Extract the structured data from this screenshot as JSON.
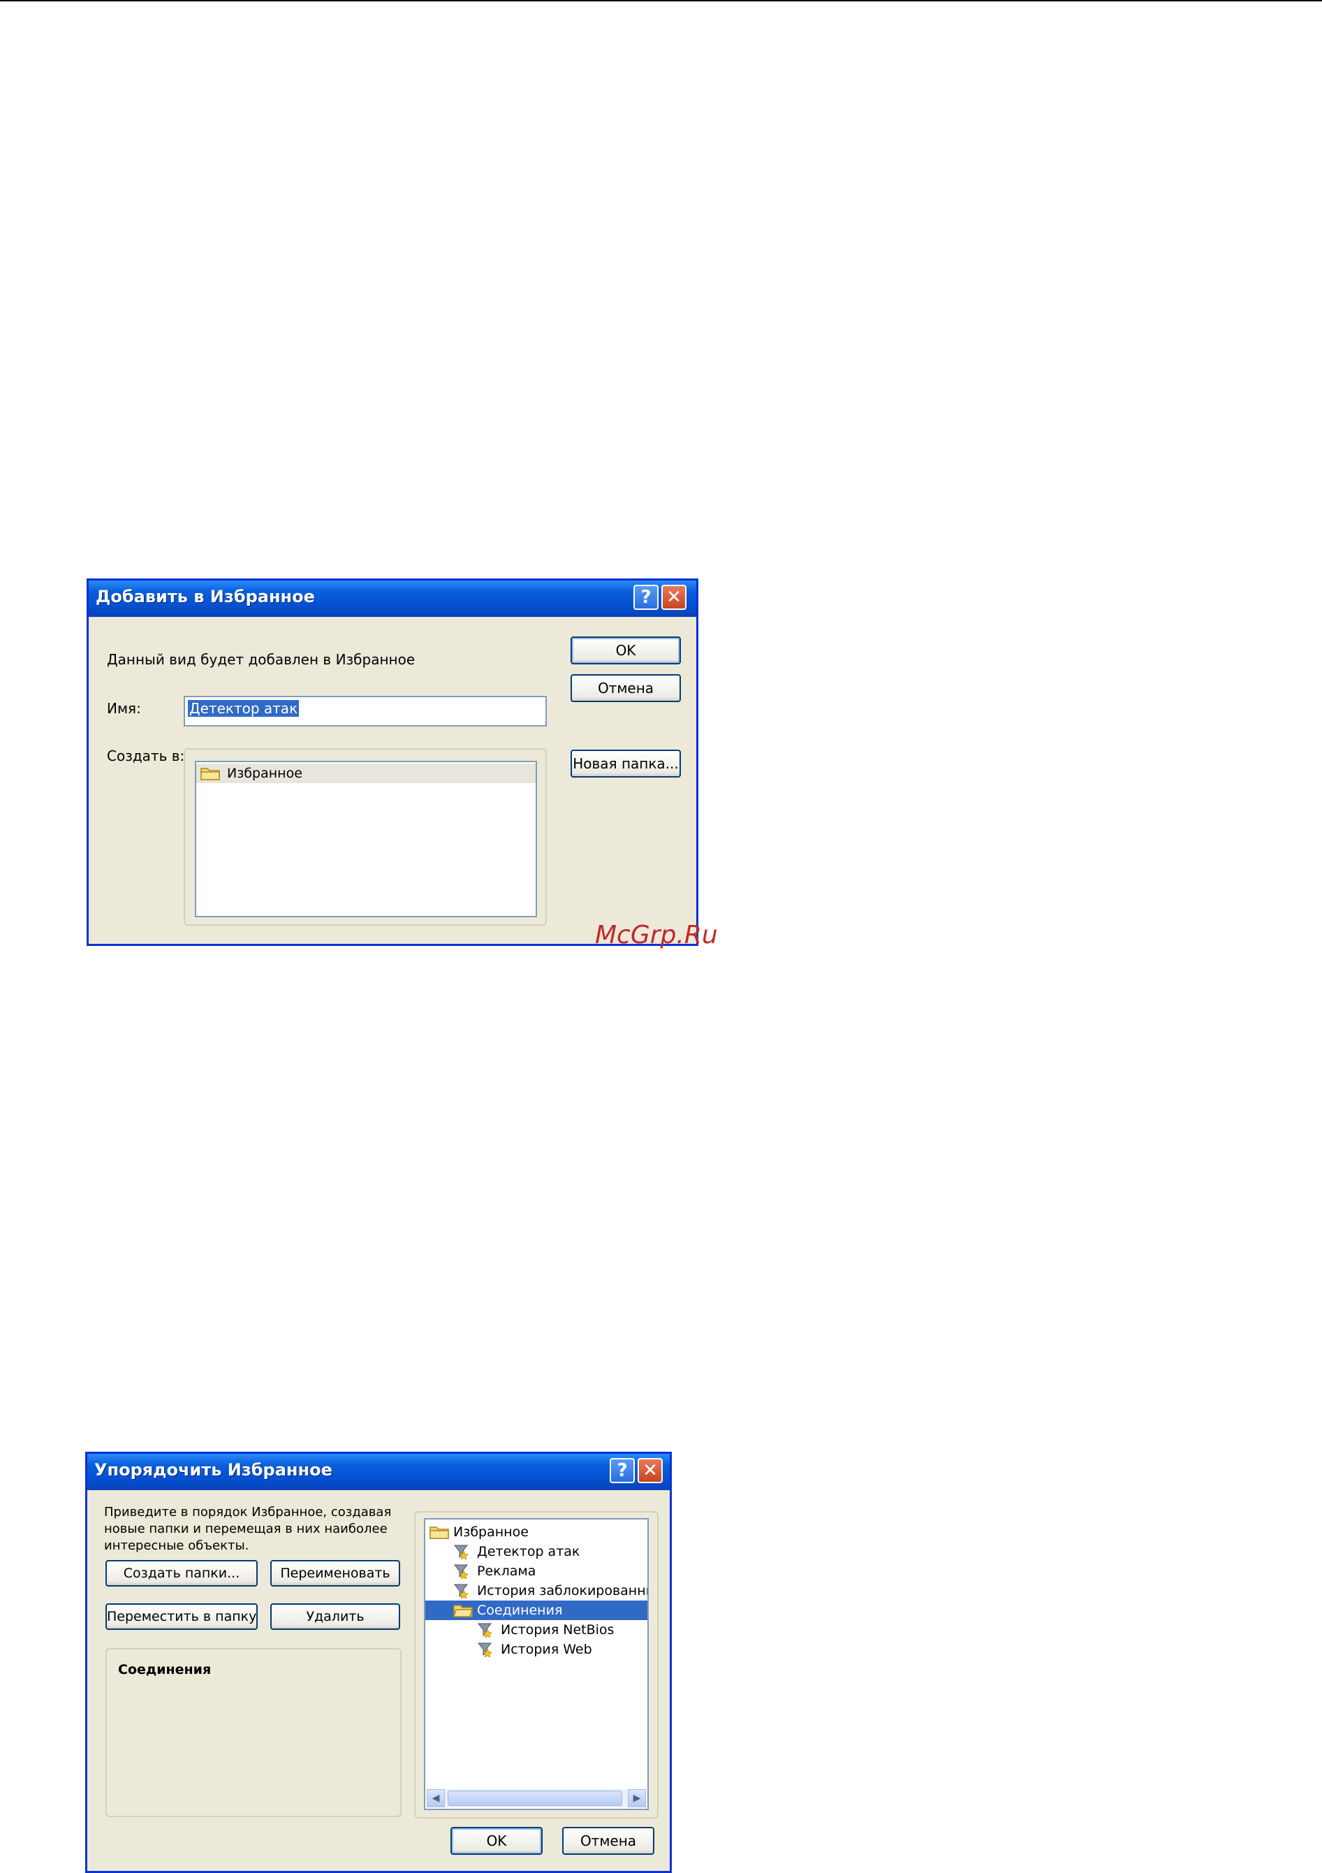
{
  "dialog1": {
    "title": "Добавить в Избранное",
    "help_icon": "?",
    "close_icon": "✕",
    "message": "Данный вид будет добавлен в Избранное",
    "name_label": "Имя:",
    "name_value": "Детектор атак",
    "create_in_label": "Создать в:",
    "tree_item": "Избранное",
    "ok_label": "OK",
    "cancel_label": "Отмена",
    "new_folder_label": "Новая папка..."
  },
  "watermark": "McGrp.Ru",
  "dialog2": {
    "title": "Упорядочить Избранное",
    "help_icon": "?",
    "close_icon": "✕",
    "description": "Приведите в порядок Избранное, создавая новые папки и перемещая в них наиболее интересные объекты.",
    "desc_line1": "Приведите в порядок Избранное, создавая",
    "desc_line2": "новые папки и перемещая в них наиболее",
    "desc_line3": "интересные объекты.",
    "create_folder_label": "Создать папки...",
    "rename_label": "Переименовать",
    "move_label": "Переместить в папку...",
    "delete_label": "Удалить",
    "selected_item": "Соединения",
    "tree": {
      "root": "Избранное",
      "items": [
        "Детектор атак",
        "Реклама",
        "История заблокированных",
        "Соединения",
        "История NetBios",
        "История Web"
      ]
    },
    "ok_label": "OK",
    "cancel_label": "Отмена"
  }
}
